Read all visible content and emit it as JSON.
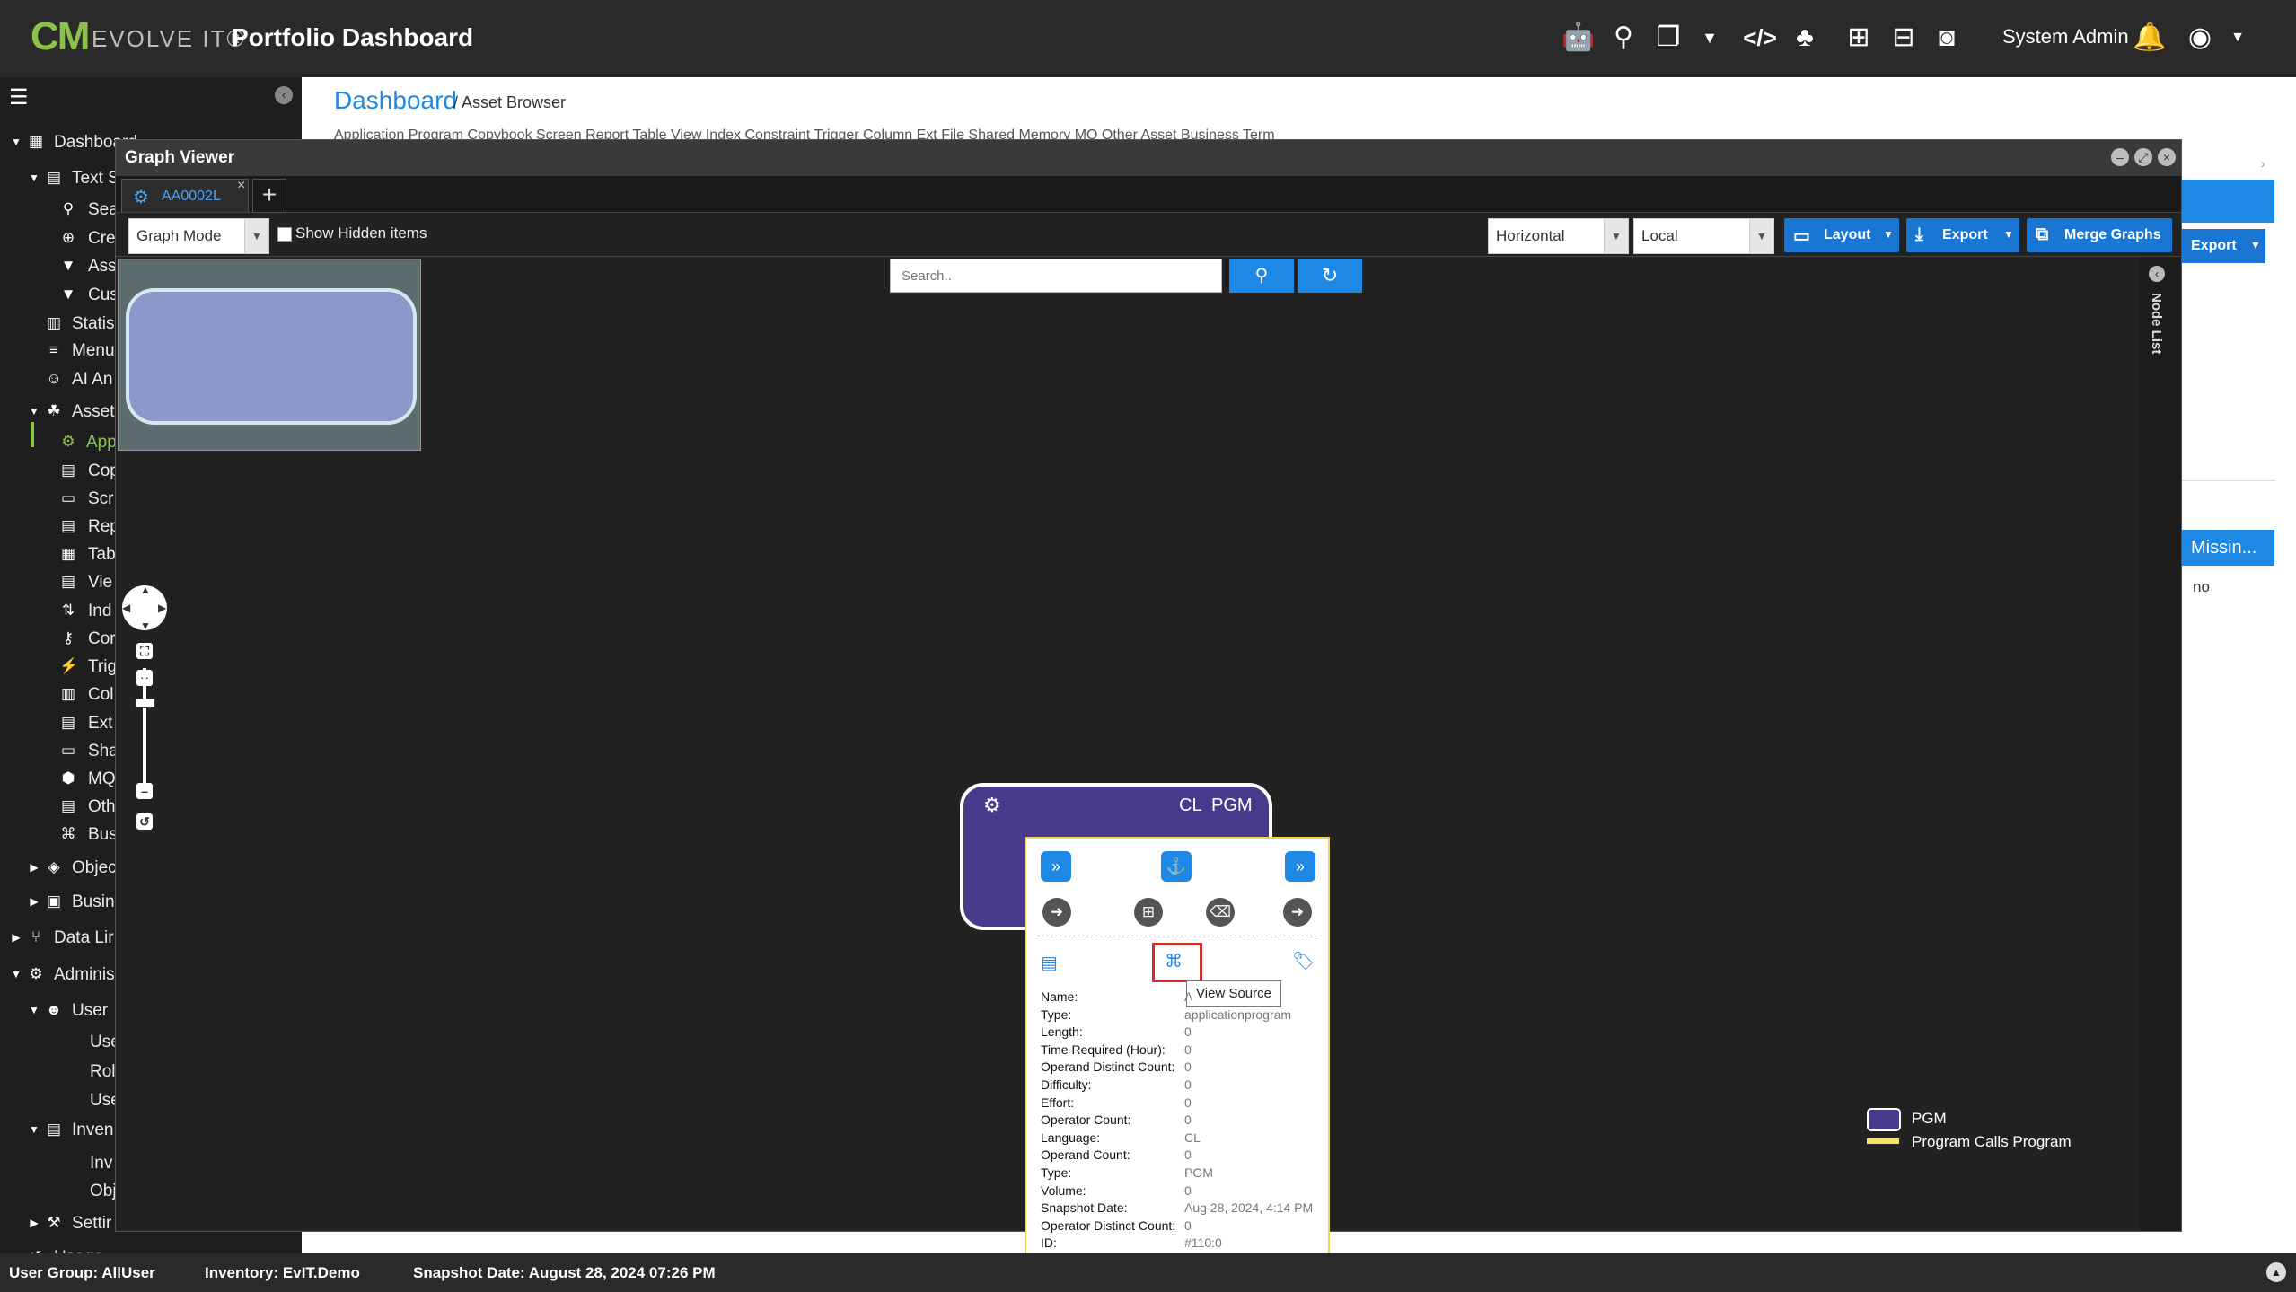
{
  "header": {
    "logo_cm": "CM",
    "logo_evolve": "EVOLVE IT®",
    "title": "Portfolio Dashboard",
    "user": "System Admin",
    "icons": [
      "robot-icon",
      "search-icon",
      "windows-icon",
      "chevron-down-icon",
      "code-icon",
      "tree-icon",
      "sitemap-icon",
      "network-icon",
      "camera-icon"
    ]
  },
  "sidebar": {
    "items": [
      {
        "label": "Dashboard",
        "icon": "dashboard-icon"
      },
      {
        "label": "Text S",
        "icon": "file-icon"
      },
      {
        "label": "Sea",
        "icon": "search-icon"
      },
      {
        "label": "Cre",
        "icon": "create-icon"
      },
      {
        "label": "Ass",
        "icon": "filter-icon"
      },
      {
        "label": "Cus",
        "icon": "filter-icon"
      },
      {
        "label": "Statis",
        "icon": "stats-icon"
      },
      {
        "label": "Menu",
        "icon": "menu-icon"
      },
      {
        "label": "AI An",
        "icon": "robot-icon"
      },
      {
        "label": "Asset",
        "icon": "assets-icon"
      },
      {
        "label": "App",
        "icon": "gear-icon"
      },
      {
        "label": "Cop",
        "icon": "copybook-icon"
      },
      {
        "label": "Scr",
        "icon": "screen-icon"
      },
      {
        "label": "Rep",
        "icon": "report-icon"
      },
      {
        "label": "Tab",
        "icon": "table-icon"
      },
      {
        "label": "Vie",
        "icon": "view-icon"
      },
      {
        "label": "Ind",
        "icon": "index-icon"
      },
      {
        "label": "Cor",
        "icon": "key-icon"
      },
      {
        "label": "Trig",
        "icon": "trigger-icon"
      },
      {
        "label": "Col",
        "icon": "column-icon"
      },
      {
        "label": "Ext",
        "icon": "extfile-icon"
      },
      {
        "label": "Sha",
        "icon": "memory-icon"
      },
      {
        "label": "MQ",
        "icon": "mq-icon"
      },
      {
        "label": "Oth",
        "icon": "other-icon"
      },
      {
        "label": "Bus",
        "icon": "business-icon"
      },
      {
        "label": "Objec",
        "icon": "cube-icon"
      },
      {
        "label": "Busin",
        "icon": "briefcase-icon"
      },
      {
        "label": "Data Lir",
        "icon": "branch-icon"
      },
      {
        "label": "Adminis",
        "icon": "cogs-icon"
      },
      {
        "label": "User",
        "icon": "users-icon"
      },
      {
        "label": "Use",
        "icon": ""
      },
      {
        "label": "Rol",
        "icon": ""
      },
      {
        "label": "Use",
        "icon": ""
      },
      {
        "label": "Inven",
        "icon": "inventory-icon"
      },
      {
        "label": "Inv",
        "icon": ""
      },
      {
        "label": "Obj",
        "icon": ""
      },
      {
        "label": "Settir",
        "icon": "wrench-icon"
      },
      {
        "label": "Usage",
        "icon": "history-icon"
      }
    ]
  },
  "breadcrumb": {
    "home": "Dashboard",
    "rest": "/ Asset Browser"
  },
  "asset_tabs": "Application Program   Copybook   Screen   Report   Table   View   Index   Constraint   Trigger   Column   Ext File   Shared Memory   MQ   Other Asset   Business Term",
  "graph_viewer": {
    "title": "Graph Viewer",
    "tab_label": "AA0002L",
    "tab_close": "×",
    "add_tab": "+",
    "mode_select": "Graph Mode",
    "show_hidden_label": "Show Hidden items",
    "orientation_select": "Horizontal",
    "scope_select": "Local",
    "layout_button": "Layout",
    "export_button": "Export",
    "merge_button": "Merge Graphs",
    "search_placeholder": "Search..",
    "node_list_label": "Node List"
  },
  "node": {
    "language": "CL",
    "type": "PGM"
  },
  "popup": {
    "tooltip": "View Source",
    "properties": [
      {
        "k": "Name:",
        "v": "A"
      },
      {
        "k": "Type:",
        "v": "applicationprogram"
      },
      {
        "k": "Length:",
        "v": "0"
      },
      {
        "k": "Time Required (Hour):",
        "v": "0"
      },
      {
        "k": "Operand Distinct Count:",
        "v": "0"
      },
      {
        "k": "Difficulty:",
        "v": "0"
      },
      {
        "k": "Effort:",
        "v": "0"
      },
      {
        "k": "Operator Count:",
        "v": "0"
      },
      {
        "k": "Language:",
        "v": "CL"
      },
      {
        "k": "Operand Count:",
        "v": "0"
      },
      {
        "k": "Type:",
        "v": "PGM"
      },
      {
        "k": "Volume:",
        "v": "0"
      },
      {
        "k": "Snapshot Date:",
        "v": "Aug 28, 2024, 4:14 PM"
      },
      {
        "k": "Operator Distinct Count:",
        "v": "0"
      },
      {
        "k": "ID:",
        "v": "#110:0"
      }
    ]
  },
  "legend": {
    "pgm": "PGM",
    "calls": "Program Calls Program",
    "pgm_color": "#4a3a8c",
    "calls_color": "#f2e46b"
  },
  "right_panel": {
    "export": "Export",
    "missing": "Missin...",
    "no": "no"
  },
  "status": {
    "user_group": "User Group: AllUser",
    "inventory": "Inventory: EvIT.Demo",
    "snapshot": "Snapshot Date: August 28, 2024 07:26 PM"
  }
}
